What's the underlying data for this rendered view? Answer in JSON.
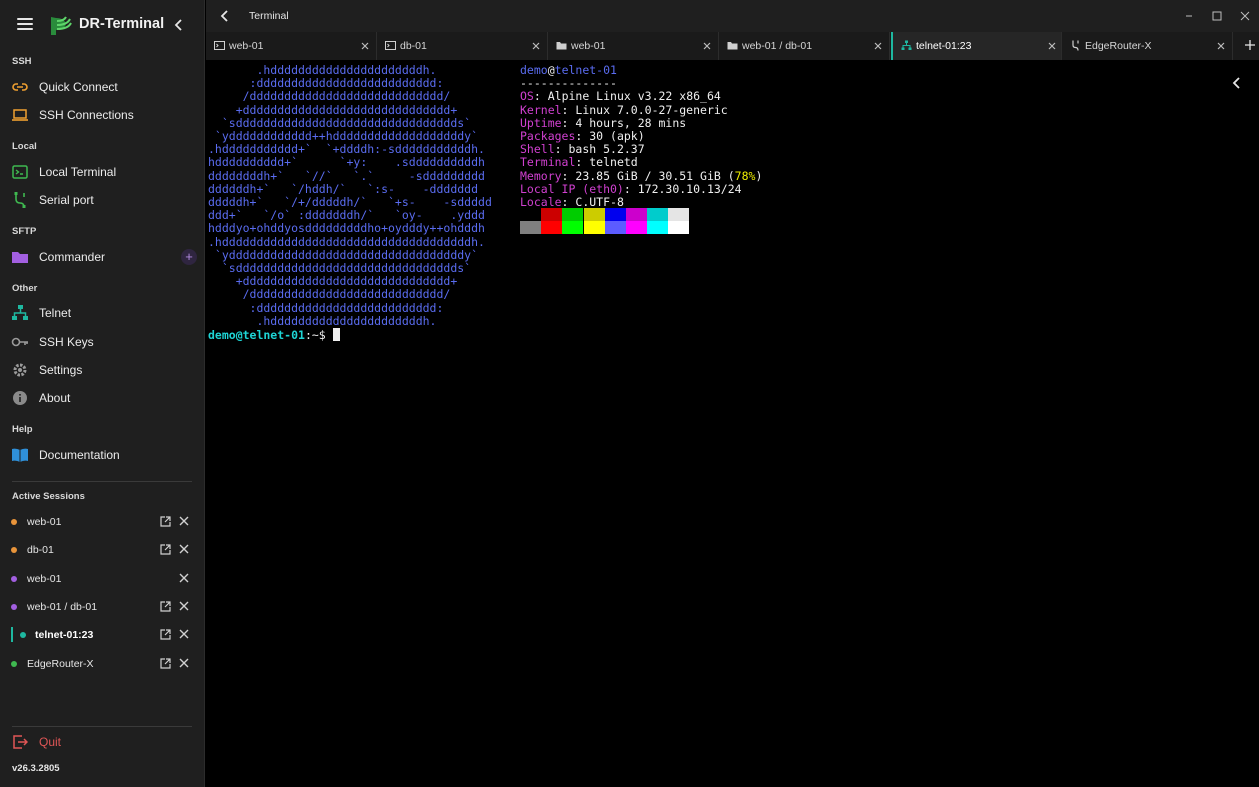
{
  "app": {
    "name": "DR-Terminal",
    "version": "v26.3.2805"
  },
  "header": {
    "title": "Terminal"
  },
  "sections": {
    "ssh": "SSH",
    "local": "Local",
    "sftp": "SFTP",
    "other": "Other",
    "help": "Help",
    "active_sessions": "Active Sessions"
  },
  "nav": {
    "quick_connect": "Quick Connect",
    "ssh_connections": "SSH Connections",
    "local_terminal": "Local Terminal",
    "serial_port": "Serial port",
    "commander": "Commander",
    "telnet": "Telnet",
    "ssh_keys": "SSH Keys",
    "settings": "Settings",
    "about": "About",
    "documentation": "Documentation",
    "quit": "Quit"
  },
  "sessions": [
    {
      "label": "web-01",
      "color": "#e8943a"
    },
    {
      "label": "db-01",
      "color": "#e8943a"
    },
    {
      "label": "web-01",
      "color": "#a25fe0"
    },
    {
      "label": "web-01 / db-01",
      "color": "#a25fe0"
    },
    {
      "label": "telnet-01:23",
      "color": "#1eb8a0",
      "active": true
    },
    {
      "label": "EdgeRouter-X",
      "color": "#3fb950"
    }
  ],
  "tabs": [
    {
      "label": "web-01",
      "icon": "terminal-icon"
    },
    {
      "label": "db-01",
      "icon": "terminal-icon"
    },
    {
      "label": "web-01",
      "icon": "folder-icon"
    },
    {
      "label": "web-01 / db-01",
      "icon": "folder-icon"
    },
    {
      "label": "telnet-01:23",
      "icon": "telnet-icon",
      "active": true
    },
    {
      "label": "EdgeRouter-X",
      "icon": "serial-icon"
    }
  ],
  "terminal": {
    "ascii_art": "       .hddddddddddddddddddddddh.\n      :dddddddddddddddddddddddddd:\n     /dddddddddddddddddddddddddddd/\n    +dddddddddddddddddddddddddddddd+\n  `sdddddddddddddddddddddddddddddddds`\n `ydddddddddddd++hdddddddddddddddddddy`\n.hddddddddddd+`  `+ddddh:-sdddddddddddh.\nhdddddddddd+`      `+y:    .sddddddddddh\nddddddddh+`   `//`   `.`     -sddddddddd\nddddddh+`   `/hddh/`   `:s-    -ddddddd\ndddddh+`   `/+/dddddh/`   `+s-    -sddddd\nddd+`   `/o` :dddddddh/`   `oy-    .yddd\nhdddyo+ohddyosdddddddddho+oydddy++ohdddh\n.hddddddddddddddddddddddddddddddddddddh.\n `yddddddddddddddddddddddddddddddddddy`\n  `sdddddddddddddddddddddddddddddddds`\n    +dddddddddddddddddddddddddddddd+\n     /dddddddddddddddddddddddddddd/\n      :dddddddddddddddddddddddddd:\n       .hddddddddddddddddddddddh.",
    "info": {
      "user": "demo",
      "at": "@",
      "host": "telnet-01",
      "separator": "--------------",
      "os_key": "OS",
      "os": "Alpine Linux v3.22 x86_64",
      "kernel_key": "Kernel",
      "kernel": "Linux 7.0.0-27-generic",
      "uptime_key": "Uptime",
      "uptime": "4 hours, 28 mins",
      "packages_key": "Packages",
      "packages": "30 (apk)",
      "shell_key": "Shell",
      "shell": "bash 5.2.37",
      "terminal_key": "Terminal",
      "terminal": "telnetd",
      "memory_key": "Memory",
      "memory": "23.85 GiB / 30.51 GiB (",
      "memory_pct": "78%",
      "memory_close": ")",
      "localip_key": "Local IP (eth0)",
      "localip": "172.30.10.13/24",
      "locale_key": "Locale",
      "locale": "C.UTF-8"
    },
    "palette_top": [
      "#000000",
      "#cc0000",
      "#00cc00",
      "#cccc00",
      "#0000ee",
      "#cc00cc",
      "#00cccc",
      "#e5e5e5"
    ],
    "palette_bottom": [
      "#7f7f7f",
      "#ff0000",
      "#00ff00",
      "#ffff00",
      "#5c5cff",
      "#ff00ff",
      "#00ffff",
      "#ffffff"
    ],
    "prompt_user": "demo@telnet-01",
    "prompt_rest": ":~$ "
  },
  "colors": {
    "accent": "#1eb8a0",
    "quit": "#e05656",
    "art": "#5a6cf0",
    "key": "#d040d0"
  }
}
